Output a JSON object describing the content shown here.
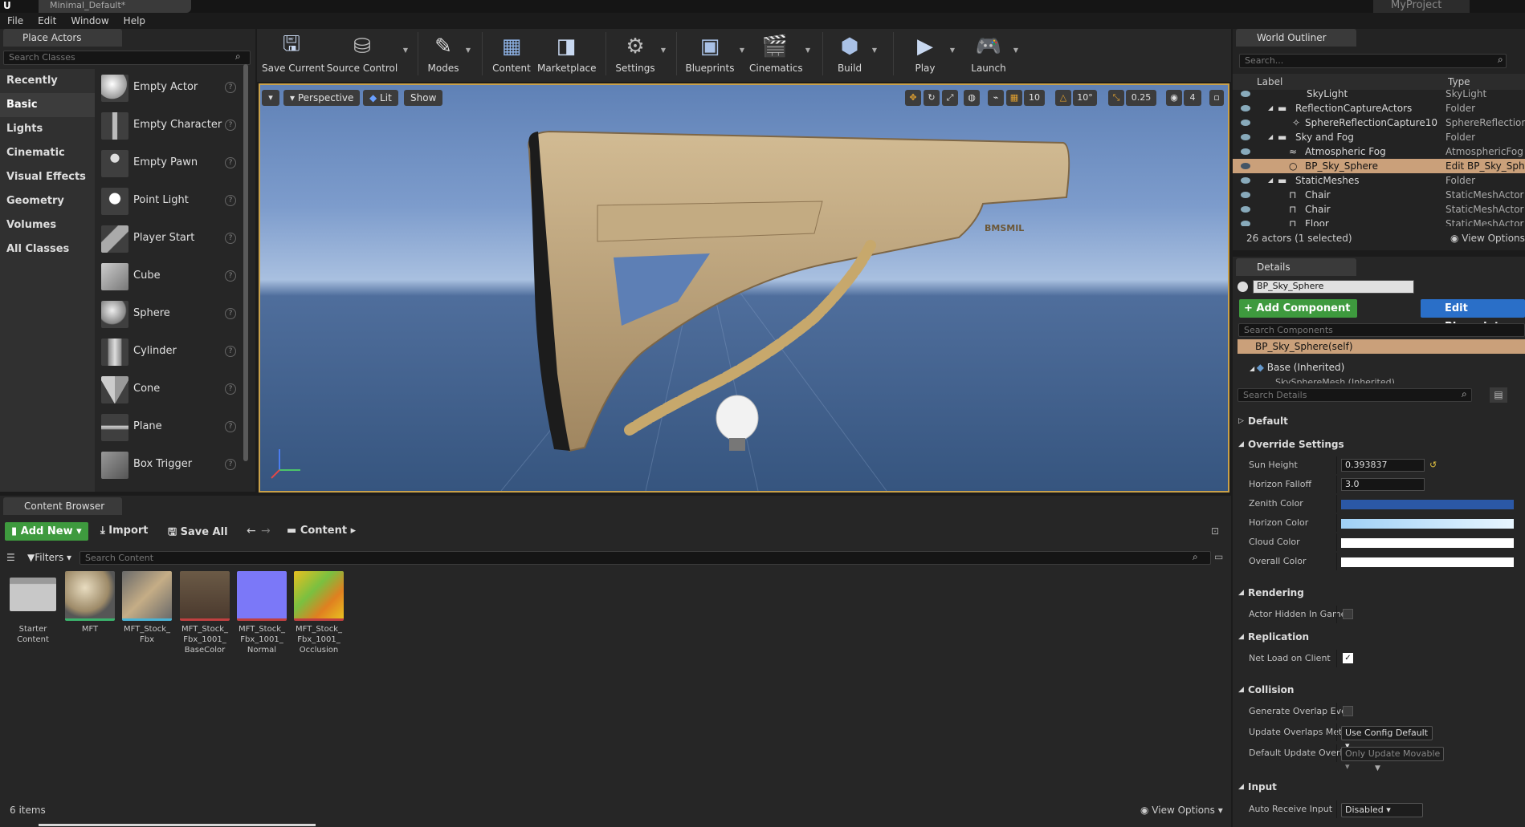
{
  "window": {
    "tab_title": "Minimal_Default*",
    "project": "MyProject"
  },
  "menu": [
    "File",
    "Edit",
    "Window",
    "Help"
  ],
  "place_actors": {
    "title": "Place Actors",
    "search_placeholder": "Search Classes",
    "categories": [
      "Recently Placed",
      "Basic",
      "Lights",
      "Cinematic",
      "Visual Effects",
      "Geometry",
      "Volumes",
      "All Classes"
    ],
    "selected_category": "Basic",
    "items": [
      "Empty Actor",
      "Empty Character",
      "Empty Pawn",
      "Point Light",
      "Player Start",
      "Cube",
      "Sphere",
      "Cylinder",
      "Cone",
      "Plane",
      "Box Trigger"
    ]
  },
  "toolbar": {
    "buttons": [
      "Save Current",
      "Source Control",
      "Modes",
      "Content",
      "Marketplace",
      "Settings",
      "Blueprints",
      "Cinematics",
      "Build",
      "Play",
      "Launch"
    ]
  },
  "viewport": {
    "perspective": "Perspective",
    "lit": "Lit",
    "show": "Show",
    "grid_snap": "10",
    "rot_snap": "10°",
    "scale_snap": "0.25",
    "cam_speed": "4",
    "stock_text": "BMSMIL"
  },
  "outliner": {
    "title": "World Outliner",
    "search_placeholder": "Search...",
    "col_label": "Label",
    "col_type": "Type",
    "rows": [
      {
        "label": "SkyLight",
        "type": "SkyLight"
      },
      {
        "label": "ReflectionCaptureActors",
        "type": "Folder"
      },
      {
        "label": "SphereReflectionCapture10",
        "type": "SphereReflectionC"
      },
      {
        "label": "Sky and Fog",
        "type": "Folder"
      },
      {
        "label": "Atmospheric Fog",
        "type": "AtmosphericFog"
      },
      {
        "label": "BP_Sky_Sphere",
        "type": "Edit BP_Sky_Sph"
      },
      {
        "label": "StaticMeshes",
        "type": "Folder"
      },
      {
        "label": "Chair",
        "type": "StaticMeshActor"
      },
      {
        "label": "Chair",
        "type": "StaticMeshActor"
      },
      {
        "label": "Floor",
        "type": "StaticMeshActor"
      }
    ],
    "status": "26 actors (1 selected)",
    "view_options": "View Options"
  },
  "details": {
    "title": "Details",
    "name": "BP_Sky_Sphere",
    "add_component": "+ Add Component",
    "edit_blueprint": "Edit Blueprint",
    "search_components": "Search Components",
    "self_row": "BP_Sky_Sphere(self)",
    "base_row": "Base (Inherited)",
    "cut_row": "SkySphereMesh (Inherited)",
    "search_details": "Search Details",
    "sections": {
      "default": "Default",
      "override": "Override Settings",
      "rendering": "Rendering",
      "replication": "Replication",
      "collision": "Collision",
      "input": "Input"
    },
    "props": {
      "sun_height": "Sun Height",
      "sun_height_val": "0.393837",
      "horizon_falloff": "Horizon Falloff",
      "horizon_falloff_val": "3.0",
      "zenith_color": "Zenith Color",
      "horizon_color": "Horizon Color",
      "cloud_color": "Cloud Color",
      "overall_color": "Overall Color",
      "actor_hidden": "Actor Hidden In Game",
      "net_load": "Net Load on Client",
      "gen_overlap": "Generate Overlap Ever",
      "update_overlaps": "Update Overlaps Meth",
      "update_overlaps_val": "Use Config Default",
      "default_update": "Default Update Overla",
      "default_update_val": "Only Update Movable",
      "auto_receive": "Auto Receive Input",
      "auto_receive_val": "Disabled"
    },
    "colors": {
      "zenith": "#2b58a6",
      "cloud": "#ffffff",
      "overall": "#ffffff"
    }
  },
  "content_browser": {
    "title": "Content Browser",
    "add_new": "Add New",
    "import": "Import",
    "save_all": "Save All",
    "path": "Content",
    "filters": "Filters",
    "search_placeholder": "Search Content",
    "assets": [
      {
        "name": "Starter Content"
      },
      {
        "name": "MFT"
      },
      {
        "name": "MFT_Stock_ Fbx"
      },
      {
        "name": "MFT_Stock_ Fbx_1001_ BaseColor"
      },
      {
        "name": "MFT_Stock_ Fbx_1001_ Normal"
      },
      {
        "name": "MFT_Stock_ Fbx_1001_ Occlusion"
      }
    ],
    "item_count": "6 items",
    "view_options": "View Options"
  }
}
